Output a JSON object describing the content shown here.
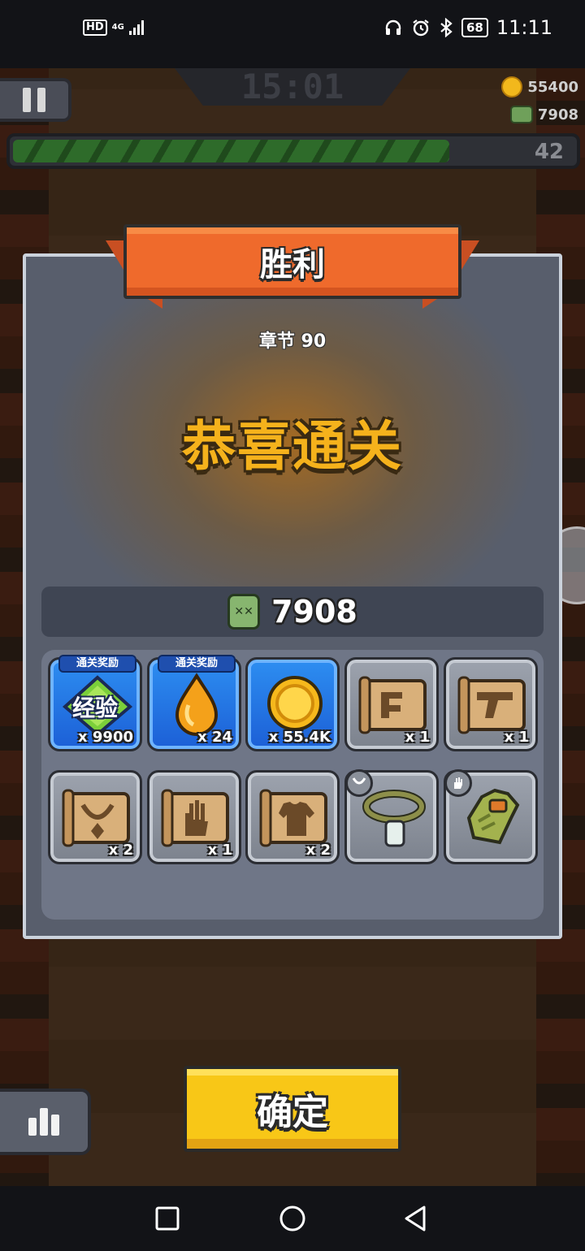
{
  "status_bar": {
    "hd": "HD",
    "network": "4G",
    "battery": "68",
    "time": "11:11",
    "icons": [
      "headphones-icon",
      "alarm-icon",
      "bluetooth-icon"
    ]
  },
  "hud": {
    "timer": "15:01",
    "coins": "55400",
    "kills": "7908",
    "level": "42",
    "progress_fraction": 0.77
  },
  "result": {
    "banner": "胜利",
    "chapter": "章节 90",
    "congrats": "恭喜通关",
    "kill_count": "7908"
  },
  "rewards": [
    {
      "type": "exp",
      "tag": "通关奖励",
      "label": "经验",
      "qty": "x 9900",
      "style": "blue",
      "icon": "exp-diamond-icon"
    },
    {
      "type": "essence",
      "tag": "通关奖励",
      "qty": "x 24",
      "style": "blue",
      "icon": "orange-drop-icon"
    },
    {
      "type": "coin",
      "qty": "x 55.4K",
      "style": "blue",
      "icon": "gold-coin-icon"
    },
    {
      "type": "scroll-weapon",
      "qty": "x 1",
      "style": "grey",
      "icon": "weapon-scroll-icon"
    },
    {
      "type": "scroll-gun",
      "qty": "x 1",
      "style": "grey",
      "icon": "gun-scroll-icon"
    },
    {
      "type": "scroll-necklace",
      "qty": "x 2",
      "style": "grey",
      "icon": "necklace-scroll-icon"
    },
    {
      "type": "scroll-glove",
      "qty": "x 1",
      "style": "grey",
      "icon": "glove-scroll-icon"
    },
    {
      "type": "scroll-armor",
      "qty": "x 2",
      "style": "grey",
      "icon": "armor-scroll-icon"
    },
    {
      "type": "necklace",
      "style": "grey",
      "icon": "dog-tag-necklace-icon",
      "badge": "necklace-slot-icon"
    },
    {
      "type": "glove",
      "style": "grey",
      "icon": "military-glove-icon",
      "badge": "glove-slot-icon"
    }
  ],
  "buttons": {
    "confirm": "确定"
  },
  "colors": {
    "banner": "#ef6a2c",
    "congrats": "#f5b21c",
    "confirm": "#f8c717",
    "reward_blue": "#2d8ef1",
    "panel": "#585e6c"
  }
}
